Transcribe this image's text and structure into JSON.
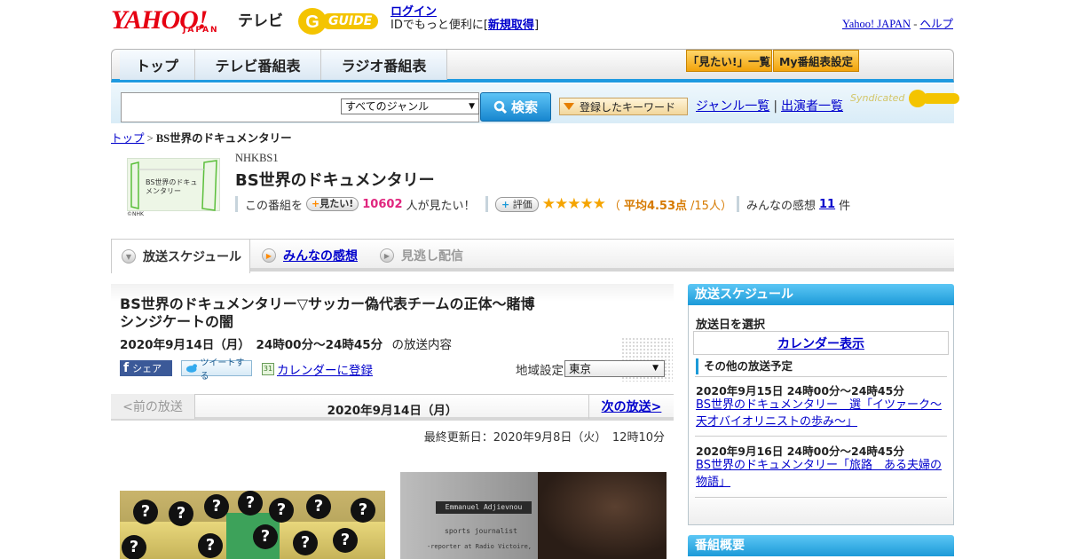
{
  "header": {
    "logo_yahoo": "YAHOO!",
    "logo_japan": "JAPAN",
    "logo_tv": "テレビ",
    "logo_gguide": "GUIDE",
    "login_label": "ログイン",
    "login_sub": "IDでもっと便利に[",
    "signup_label": "新規取得",
    "login_sub_end": "]",
    "yahoo_japan_link": "Yahoo! JAPAN",
    "help_link": "ヘルプ",
    "sep": "-"
  },
  "nav": {
    "tabs": [
      "トップ",
      "テレビ番組表",
      "ラジオ番組表"
    ],
    "mitai_list": "「見たい!」一覧",
    "my_bangumi": "My番組表設定"
  },
  "search": {
    "genre_select": "すべてのジャンル",
    "search_button": "検索",
    "keyword_button": "登録したキーワード",
    "genre_list": "ジャンル一覧",
    "performer_list": "出演者一覧",
    "syndicated": "Syndicated"
  },
  "breadcrumb": {
    "top": "トップ",
    "sep": ">",
    "current": "BS世界のドキュメンタリー"
  },
  "program": {
    "channel": "NHKBS1",
    "title": "BS世界のドキュメンタリー",
    "thumb_text": "BS世界のドキュメンタリー",
    "thumb_credit": "©NHK",
    "mitai_prefix": "この番組を",
    "mitai_btn": "見たい!",
    "mitai_count": "10602",
    "mitai_suffix": "人が見たい！",
    "hyoka_btn": "評価",
    "stars": "★★★★★",
    "avg_prefix": "（",
    "avg": "平均4.53点",
    "avg_suffix": "/15人）",
    "kansou_prefix": "みんなの感想",
    "kansou_count": "11",
    "kansou_suffix": "件"
  },
  "tabs": {
    "schedule": "放送スケジュール",
    "kansou": "みんなの感想",
    "minogashi": "見逃し配信"
  },
  "episode": {
    "title": "BS世界のドキュメンタリー▽サッカー偽代表チームの正体～賭博シンジケートの闇",
    "time": "2020年9月14日（月）　24時00分～24時45分",
    "time_suffix": "の放送内容",
    "share_fb": "シェア",
    "share_tw": "ツイートする",
    "calendar_register": "カレンダーに登録",
    "region_label": "地域設定",
    "region_value": "東京"
  },
  "datenav": {
    "prev": "<前の放送",
    "date": "2020年9月14日（月）",
    "next": "次の放送>"
  },
  "updated": "最終更新日：2020年9月8日（火）　12時10分",
  "photo2_caption": "Emmanuel Adjievnou",
  "photo2_sub": "sports journalist",
  "photo2_sub2": "-reporter at Radio Victoire,",
  "sidebar": {
    "head": "放送スケジュール",
    "select_label": "放送日を選択",
    "calendar": "カレンダー表示",
    "other": "その他の放送予定",
    "items": [
      {
        "date": "2020年9月15日 24時00分～24時45分",
        "title": "BS世界のドキュメンタリー　選「イツァーク～天才バイオリニストの歩み～」"
      },
      {
        "date": "2020年9月16日 24時00分～24時45分",
        "title": "BS世界のドキュメンタリー「旅路　ある夫婦の物語」"
      }
    ],
    "head2": "番組概要"
  }
}
